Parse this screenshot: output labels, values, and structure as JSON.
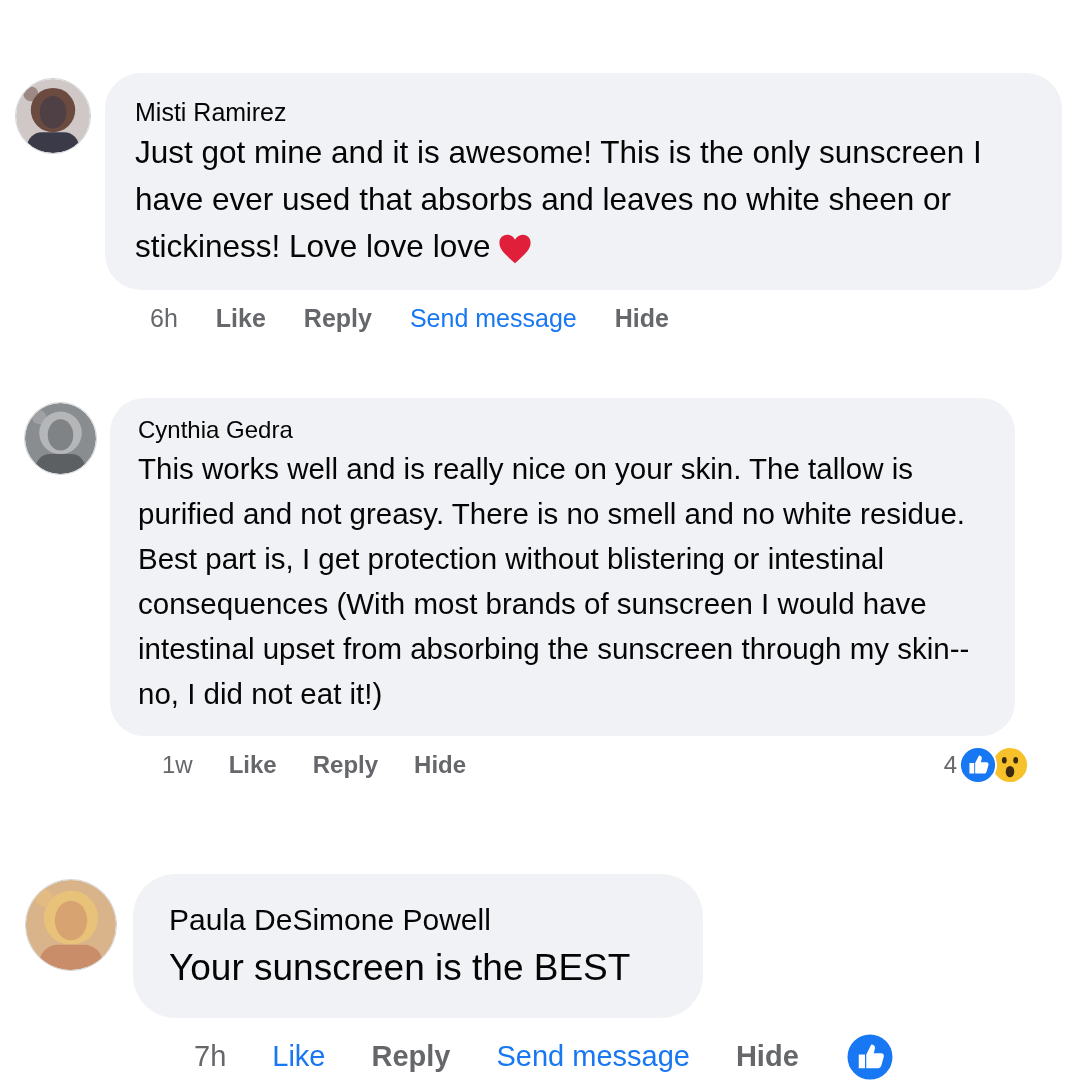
{
  "comments": [
    {
      "name": "Misti Ramirez",
      "text": "Just got mine and it is awesome! This is the only sunscreen I have ever used that absorbs and leaves no white sheen or stickiness! Love love love",
      "emoji": {
        "kind": "heart"
      },
      "time": "6h",
      "actions": [
        {
          "kind": "like",
          "label": "Like",
          "selected": false
        },
        {
          "kind": "reply",
          "label": "Reply"
        },
        {
          "kind": "link",
          "label": "Send message"
        },
        {
          "kind": "hide",
          "label": "Hide"
        }
      ]
    },
    {
      "name": "Cynthia Gedra",
      "text": "This works well and is really nice on your skin. The tallow is purified and not greasy. There is no smell and no white residue. Best part is, I get protection without blistering or intestinal consequences (With most brands of sunscreen I would have intestinal upset from absorbing the sunscreen through my skin--no, I did not eat it!)",
      "time": "1w",
      "actions": [
        {
          "kind": "like",
          "label": "Like",
          "selected": false
        },
        {
          "kind": "reply",
          "label": "Reply"
        },
        {
          "kind": "hide",
          "label": "Hide"
        }
      ],
      "reactions": {
        "count": "4",
        "items": [
          {
            "kind": "like"
          },
          {
            "kind": "wow"
          }
        ]
      }
    },
    {
      "name": "Paula DeSimone Powell",
      "text": "Your sunscreen is the BEST",
      "time": "7h",
      "actions": [
        {
          "kind": "like",
          "label": "Like",
          "selected": true
        },
        {
          "kind": "reply",
          "label": "Reply"
        },
        {
          "kind": "link",
          "label": "Send message"
        },
        {
          "kind": "hide",
          "label": "Hide"
        }
      ],
      "reactions": {
        "items": [
          {
            "kind": "like"
          }
        ]
      }
    }
  ]
}
